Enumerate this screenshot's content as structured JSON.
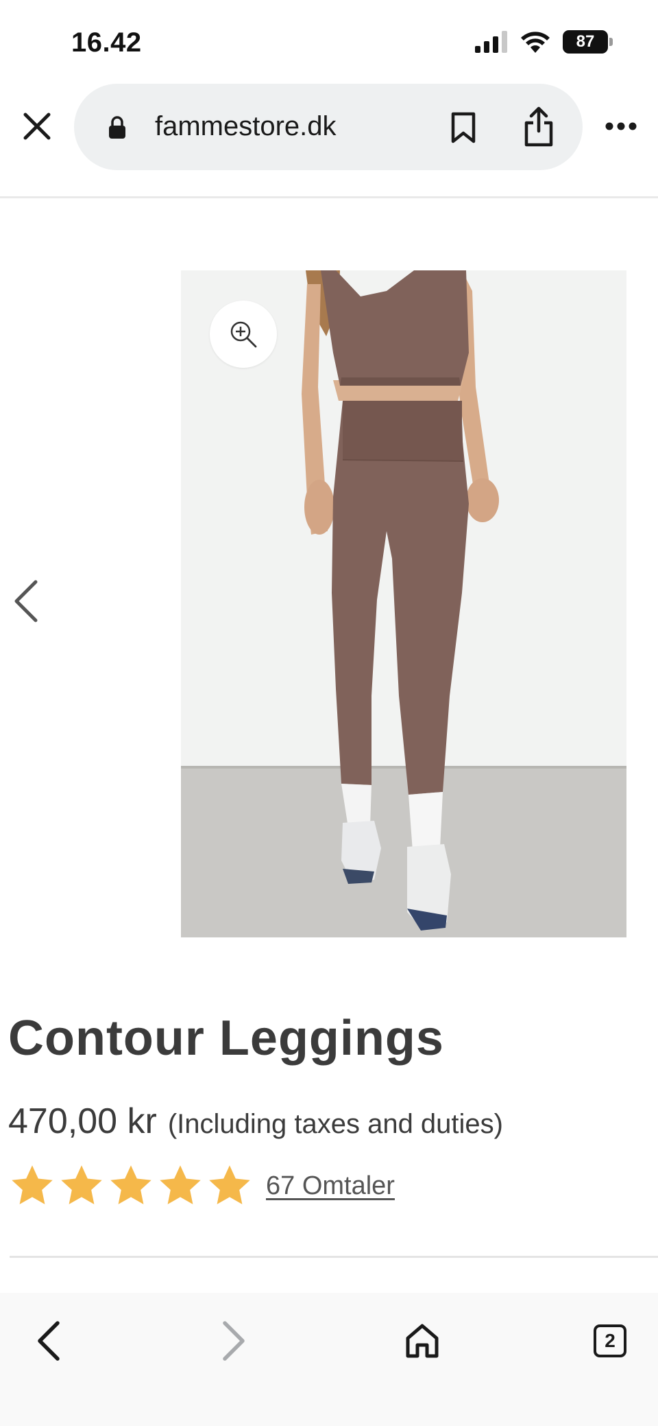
{
  "status_bar": {
    "time": "16.42",
    "battery": "87"
  },
  "browser": {
    "url": "fammestore.dk",
    "tab_count": "2"
  },
  "product": {
    "title": "Contour Leggings",
    "price": "470,00 kr",
    "price_note": "(Including taxes and duties)",
    "rating": 5,
    "reviews_label": "67 Omtaler"
  },
  "icons": {
    "close": "close-icon",
    "lock": "lock-icon",
    "bookmark": "bookmark-icon",
    "share": "share-icon",
    "more": "more-icon",
    "zoom": "zoom-in-icon",
    "gallery_prev": "chevron-left-icon",
    "back": "back-icon",
    "forward": "forward-icon",
    "home": "home-icon",
    "tabs": "tabs-icon"
  },
  "colors": {
    "star": "#f5b84a",
    "text": "#3b3b3b",
    "url_pill": "#eef0f1",
    "legging": "#80625a"
  }
}
